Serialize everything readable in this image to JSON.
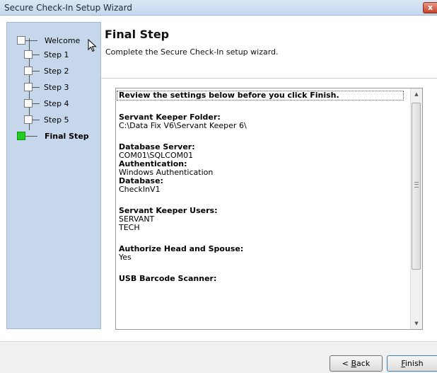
{
  "window": {
    "title": "Secure Check-In Setup Wizard",
    "close_label": "x"
  },
  "sidebar": {
    "steps": [
      {
        "label": "Welcome"
      },
      {
        "label": "Step 1"
      },
      {
        "label": "Step 2"
      },
      {
        "label": "Step 3"
      },
      {
        "label": "Step 4"
      },
      {
        "label": "Step 5"
      },
      {
        "label": "Final Step",
        "current": true
      }
    ]
  },
  "header": {
    "title": "Final Step",
    "subtitle": "Complete the Secure Check-In setup wizard."
  },
  "review": {
    "headline": "Review the settings below before you click Finish.",
    "servant_keeper_folder_label": "Servant Keeper Folder:",
    "servant_keeper_folder_value": "C:\\Data Fix V6\\Servant Keeper 6\\",
    "database_server_label": "Database Server:",
    "database_server_value": "COM01\\SQLCOM01",
    "authentication_label": "Authentication:",
    "authentication_value": "Windows Authentication",
    "database_label": "Database:",
    "database_value": "CheckInV1",
    "users_label": "Servant Keeper Users:",
    "users": [
      "SERVANT",
      "TECH"
    ],
    "authorize_label": "Authorize Head and Spouse:",
    "authorize_value": "Yes",
    "scanner_label": "USB Barcode Scanner:"
  },
  "footer": {
    "back_prefix": "< ",
    "back_mnemonic": "B",
    "back_rest": "ack",
    "finish_mnemonic": "F",
    "finish_rest": "inish"
  }
}
